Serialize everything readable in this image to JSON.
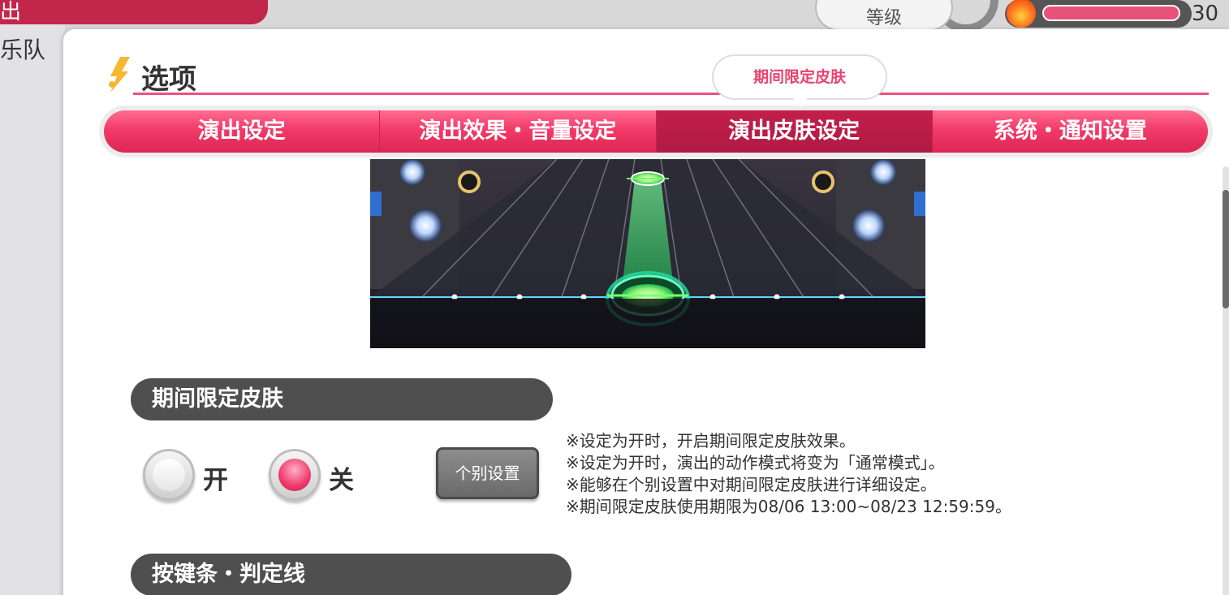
{
  "background": {
    "top_left_text": "出",
    "band_label": "乐队",
    "level_label": "等级",
    "stamina_value": "30 /"
  },
  "modal": {
    "title": "选项",
    "tooltip": "期间限定皮肤",
    "tabs": [
      {
        "label": "演出设定",
        "active": false
      },
      {
        "label": "演出效果・音量设定",
        "active": false
      },
      {
        "label": "演出皮肤设定",
        "active": true
      },
      {
        "label": "系统・通知设置",
        "active": false
      }
    ],
    "section_limited_skin": {
      "header": "期间限定皮肤",
      "options": {
        "on_label": "开",
        "off_label": "关",
        "selected": "关"
      },
      "individual_button": "个别设置",
      "notes": [
        "※设定为开时，开启期间限定皮肤效果。",
        "※设定为开时，演出的动作模式将变为「通常模式」。",
        "※能够在个别设置中对期间限定皮肤进行详细设定。",
        "※期间限定皮肤使用期限为08/06 13:00~08/23 12:59:59。"
      ]
    },
    "section_lane": {
      "header": "按键条・判定线"
    }
  },
  "colors": {
    "accent": "#ef4f7c",
    "tab_active": "#b01a43",
    "section_header": "#4f4f4f"
  }
}
